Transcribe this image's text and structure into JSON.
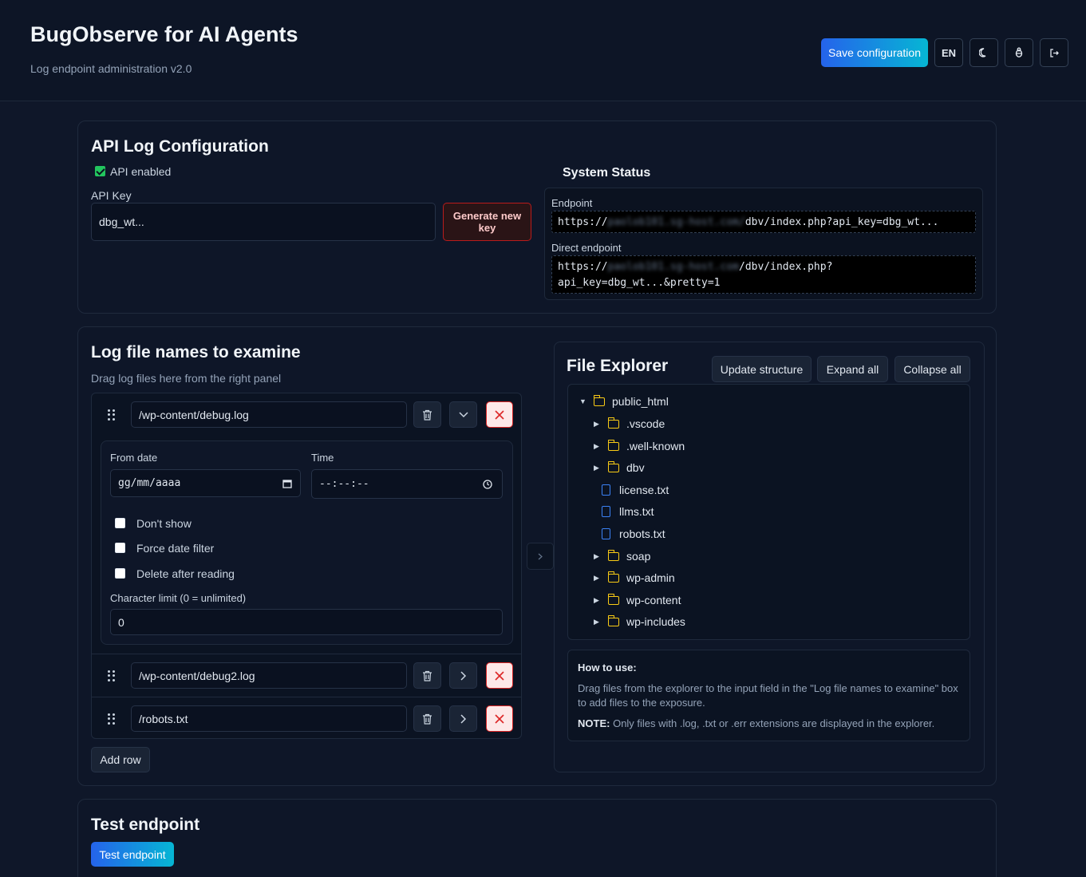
{
  "header": {
    "title": "BugObserve for AI Agents",
    "subtitle": "Log endpoint administration v2.0",
    "save_label": "Save configuration",
    "lang_label": "EN"
  },
  "api_config": {
    "title": "API Log Configuration",
    "enabled_label": "API enabled",
    "enabled": true,
    "key_label": "API Key",
    "key_value": "dbg_wt...",
    "generate_label": "Generate new key"
  },
  "system_status": {
    "title": "System Status",
    "endpoint_label": "Endpoint",
    "endpoint_prefix": "https://",
    "endpoint_host": "paolob101.sg-host.com/",
    "endpoint_suffix": "dbv/index.php?api_key=dbg_wt...",
    "direct_label": "Direct endpoint",
    "direct_prefix": "https://",
    "direct_host": "paolob101.sg-host.com",
    "direct_suffix_1": "/dbv/index.php?",
    "direct_suffix_2": "api_key=dbg_wt...&pretty=1"
  },
  "log_files": {
    "title": "Log file names to examine",
    "hint": "Drag log files here from the right panel",
    "rows": [
      {
        "path": "/wp-content/debug.log"
      },
      {
        "path": "/wp-content/debug2.log"
      },
      {
        "path": "/robots.txt"
      }
    ],
    "options": {
      "from_date_label": "From date",
      "from_date_placeholder": "gg/mm/aaaa",
      "time_label": "Time",
      "time_placeholder": "--:--:--",
      "dont_show_label": "Don't show",
      "force_filter_label": "Force date filter",
      "delete_after_label": "Delete after reading",
      "char_limit_label": "Character limit (0 = unlimited)",
      "char_limit_value": "0"
    },
    "add_row_label": "Add row"
  },
  "file_explorer": {
    "title": "File Explorer",
    "update_label": "Update structure",
    "expand_label": "Expand all",
    "collapse_label": "Collapse all",
    "root": "public_html",
    "items": [
      {
        "name": ".vscode",
        "type": "folder"
      },
      {
        "name": ".well-known",
        "type": "folder"
      },
      {
        "name": "dbv",
        "type": "folder"
      },
      {
        "name": "license.txt",
        "type": "file"
      },
      {
        "name": "llms.txt",
        "type": "file"
      },
      {
        "name": "robots.txt",
        "type": "file"
      },
      {
        "name": "soap",
        "type": "folder"
      },
      {
        "name": "wp-admin",
        "type": "folder"
      },
      {
        "name": "wp-content",
        "type": "folder"
      },
      {
        "name": "wp-includes",
        "type": "folder"
      }
    ],
    "howto_title": "How to use:",
    "howto_text": "Drag files from the explorer to the input field in the \"Log file names to examine\" box to add files to the exposure.",
    "note_label": "NOTE:",
    "note_text": "Only files with .log, .txt or .err extensions are displayed in the explorer."
  },
  "test": {
    "title": "Test endpoint",
    "button_label": "Test endpoint"
  }
}
